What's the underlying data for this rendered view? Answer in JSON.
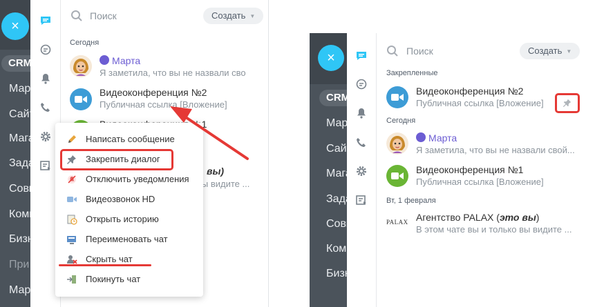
{
  "left_screen": {
    "close_glyph": "×",
    "bg_items": [
      "CRM",
      "Марк",
      "Сайт",
      "Мага",
      "Зада",
      "Совм",
      "Комм",
      "Бизн",
      "При",
      "Марк"
    ],
    "search": {
      "placeholder": "Поиск"
    },
    "create_label": "Создать",
    "section_today": "Сегодня",
    "chats": [
      {
        "title": "Марта",
        "preview": "Я заметила, что вы не назвали свой..."
      },
      {
        "title": "Видеоконференция №2",
        "preview": "Публичная ссылка [Вложение]"
      },
      {
        "title": "Видеоконференция №1",
        "preview": ""
      },
      {
        "title": "вы)",
        "preview": "вы видите ..."
      }
    ],
    "context_menu": [
      {
        "label": "Написать сообщение",
        "icon": "pencil-icon"
      },
      {
        "label": "Закрепить диалог",
        "icon": "pin-icon"
      },
      {
        "label": "Отключить уведомления",
        "icon": "mute-icon"
      },
      {
        "label": "Видеозвонок HD",
        "icon": "video-icon"
      },
      {
        "label": "Открыть историю",
        "icon": "history-icon"
      },
      {
        "label": "Переименовать чат",
        "icon": "rename-icon"
      },
      {
        "label": "Скрыть чат",
        "icon": "hide-icon"
      },
      {
        "label": "Покинуть чат",
        "icon": "leave-icon"
      }
    ]
  },
  "right_screen": {
    "close_glyph": "×",
    "bg_items": [
      "CRM",
      "Марк",
      "Сайт",
      "Мага",
      "Зада",
      "Совм",
      "Комм",
      "Бизн"
    ],
    "search": {
      "placeholder": "Поиск"
    },
    "create_label": "Создать",
    "section_pinned": "Закрепленные",
    "pinned_chat": {
      "title": "Видеоконференция №2",
      "preview": "Публичная ссылка [Вложение]"
    },
    "section_today": "Сегодня",
    "today_chats": [
      {
        "title": "Марта",
        "preview": "Я заметила, что вы не назвали свой..."
      },
      {
        "title": "Видеоконференция №1",
        "preview": "Публичная ссылка [Вложение]"
      }
    ],
    "section_date": "Вт, 1 февраля",
    "date_chat": {
      "title_prefix": "Агентство PALAX (",
      "title_em": "это вы",
      "title_suffix": ")",
      "preview": "В этом чате вы и только вы видите ...",
      "logo_text": "PALAX"
    }
  },
  "colors": {
    "accent": "#2fc6f6",
    "highlight": "#e53935",
    "bot_purple": "#6c5dd3"
  }
}
